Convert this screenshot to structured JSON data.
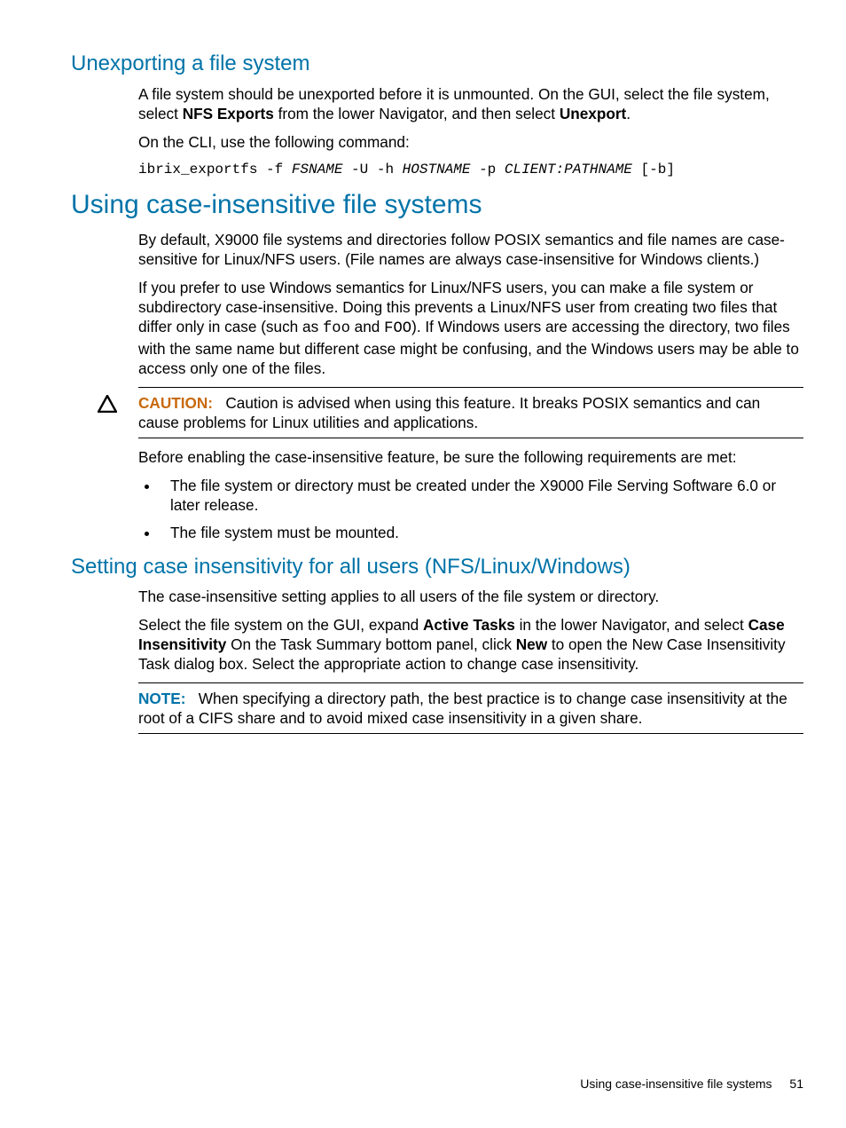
{
  "section1": {
    "heading": "Unexporting a file system",
    "p1_a": "A file system should be unexported before it is unmounted. On the GUI, select the file system, select ",
    "p1_b": "NFS Exports",
    "p1_c": " from the lower Navigator, and then select ",
    "p1_d": "Unexport",
    "p1_e": ".",
    "p2": "On the CLI, use the following command:",
    "code_a": "ibrix_exportfs -f ",
    "code_b": "FSNAME",
    "code_c": " -U -h ",
    "code_d": "HOSTNAME",
    "code_e": " -p ",
    "code_f": "CLIENT:PATHNAME",
    "code_g": " [-b]"
  },
  "section2": {
    "heading": "Using case-insensitive file systems",
    "p1": "By default, X9000 file systems and directories follow POSIX semantics and file names are case-sensitive for Linux/NFS users. (File names are always case-insensitive for Windows clients.)",
    "p2_a": "If you prefer to use Windows semantics for Linux/NFS users, you can make a file system or subdirectory case-insensitive. Doing this prevents a Linux/NFS user from creating two files that differ only in case (such as ",
    "p2_b": "foo",
    "p2_c": " and ",
    "p2_d": "FOO",
    "p2_e": "). If Windows users are accessing the directory, two files with the same name but different case might be confusing, and the Windows users may be able to access only one of the files.",
    "caution_label": "CAUTION:",
    "caution_text": "Caution is advised when using this feature. It breaks POSIX semantics and can cause problems for Linux utilities and applications.",
    "p3": "Before enabling the case-insensitive feature, be sure the following requirements are met:",
    "bullets": [
      "The file system or directory must be created under the X9000 File Serving Software 6.0 or later release.",
      "The file system must be mounted."
    ]
  },
  "section3": {
    "heading": "Setting case insensitivity for all users (NFS/Linux/Windows)",
    "p1": "The case-insensitive setting applies to all users of the file system or directory.",
    "p2_a": "Select the file system on the GUI, expand ",
    "p2_b": "Active Tasks",
    "p2_c": " in the lower Navigator, and select ",
    "p2_d": "Case Insensitivity",
    "p2_e": " On the Task Summary bottom panel, click ",
    "p2_f": "New",
    "p2_g": " to open the New Case Insensitivity Task dialog box. Select the appropriate action to change case insensitivity.",
    "note_label": "NOTE:",
    "note_text": "When specifying a directory path, the best practice is to change case insensitivity at the root of a CIFS share and to avoid mixed case insensitivity in a given share."
  },
  "footer": {
    "text": "Using case-insensitive file systems",
    "page": "51"
  }
}
